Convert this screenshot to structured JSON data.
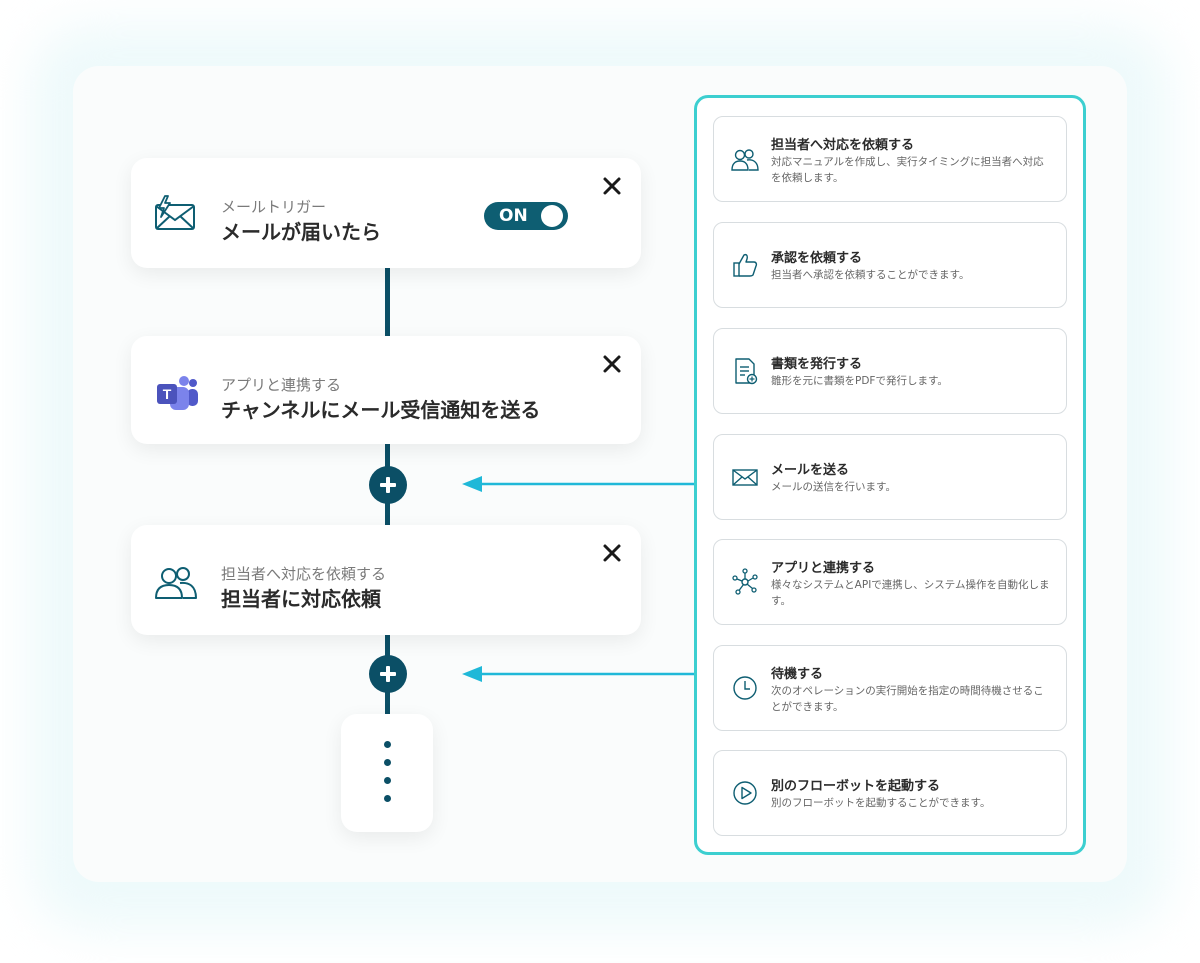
{
  "flow": {
    "trigger": {
      "subtitle": "メールトリガー",
      "title": "メールが届いたら",
      "toggle_label": "ON",
      "icon": "mail-trigger-icon"
    },
    "step1": {
      "subtitle": "アプリと連携する",
      "title": "チャンネルにメール受信通知を送る",
      "icon": "teams-icon"
    },
    "step2": {
      "subtitle": "担当者へ対応を依頼する",
      "title": "担当者に対応依頼",
      "icon": "users-icon"
    }
  },
  "operations": [
    {
      "title": "担当者へ対応を依頼する",
      "desc": "対応マニュアルを作成し、実行タイミングに担当者へ対応を依頼します。",
      "icon": "users-icon"
    },
    {
      "title": "承認を依頼する",
      "desc": "担当者へ承認を依頼することができます。",
      "icon": "thumbs-up-icon"
    },
    {
      "title": "書類を発行する",
      "desc": "雛形を元に書類をPDFで発行します。",
      "icon": "document-icon"
    },
    {
      "title": "メールを送る",
      "desc": "メールの送信を行います。",
      "icon": "envelope-icon"
    },
    {
      "title": "アプリと連携する",
      "desc": "様々なシステムとAPIで連携し、システム操作を自動化します。",
      "icon": "network-icon"
    },
    {
      "title": "待機する",
      "desc": "次のオペレーションの実行開始を指定の時間待機させることができます。",
      "icon": "clock-icon"
    },
    {
      "title": "別のフローボットを起動する",
      "desc": "別のフローボットを起動することができます。",
      "icon": "play-icon"
    }
  ],
  "colors": {
    "primary": "#0b4f66",
    "accent": "#3ccfd0",
    "arrow": "#1fb8d8"
  }
}
